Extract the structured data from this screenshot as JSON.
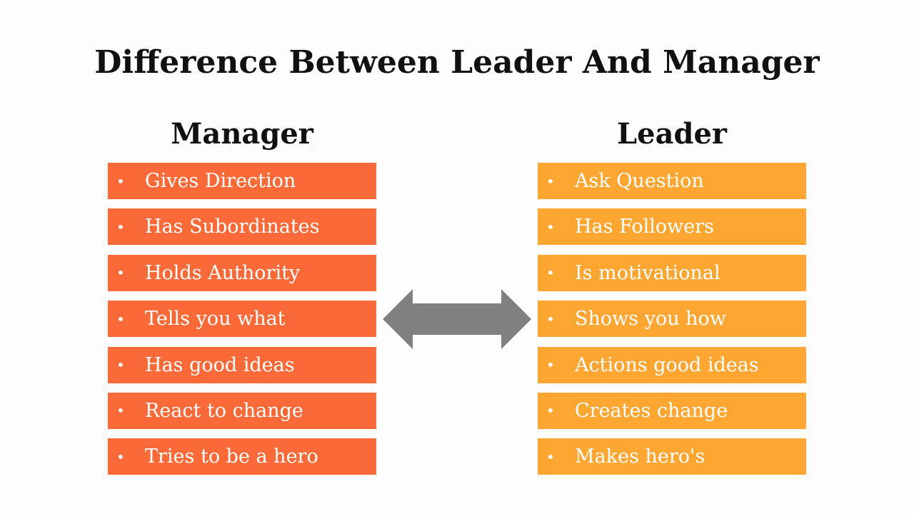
{
  "title": "Difference Between Leader And Manager",
  "manager": {
    "heading": "Manager",
    "color": "#f96a38",
    "items": [
      "Gives Direction",
      "Has Subordinates",
      "Holds Authority",
      "Tells you what",
      "Has good ideas",
      "React to change",
      "Tries to be a hero"
    ]
  },
  "leader": {
    "heading": "Leader",
    "color": "#fda632",
    "items": [
      "Ask Question",
      "Has Followers",
      "Is motivational",
      "Shows you how",
      "Actions good ideas",
      "Creates change",
      "Makes hero's"
    ]
  },
  "arrow": {
    "icon": "double-arrow-icon",
    "color": "#808080"
  }
}
